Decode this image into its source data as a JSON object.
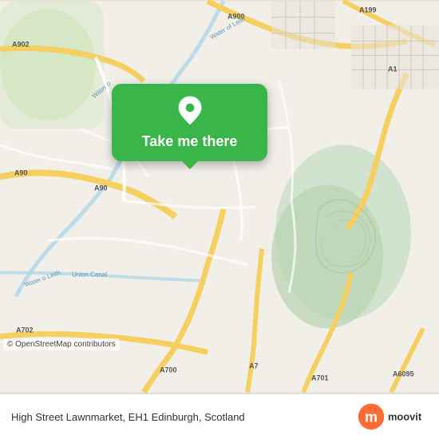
{
  "map": {
    "attribution": "© OpenStreetMap contributors"
  },
  "button": {
    "label": "Take me there",
    "bg_color": "#3ab54a"
  },
  "bottom_bar": {
    "location_text": "High Street Lawnmarket, EH1  Edinburgh, Scotland"
  },
  "moovit": {
    "logo_text": "moovit"
  }
}
